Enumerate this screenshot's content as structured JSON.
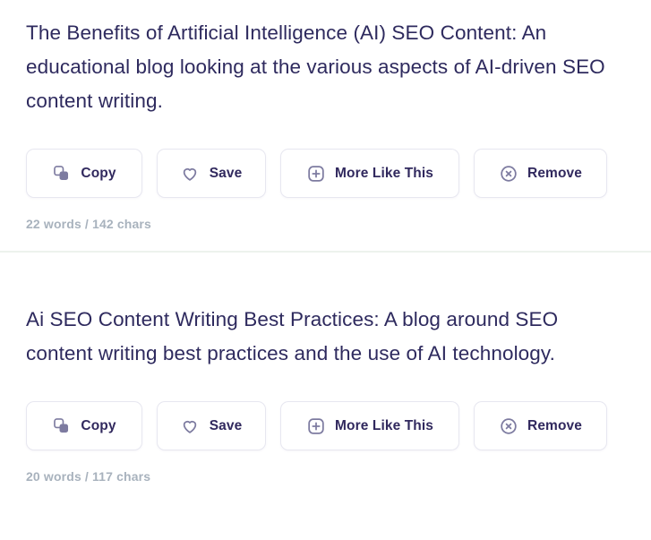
{
  "results": [
    {
      "idea": "The Benefits of Artificial Intelligence (AI) SEO Content: An educational blog looking at the various aspects of AI-driven SEO content writing.",
      "meta": "22 words / 142 chars",
      "actions": [
        {
          "label": "Copy",
          "icon": "copy-icon"
        },
        {
          "label": "Save",
          "icon": "heart-icon"
        },
        {
          "label": "More Like This",
          "icon": "plus-square-icon"
        },
        {
          "label": "Remove",
          "icon": "close-circle-icon"
        }
      ]
    },
    {
      "idea": "Ai SEO Content Writing Best Practices: A blog around SEO content writing best practices and the use of AI technology.",
      "meta": "20 words / 117 chars",
      "actions": [
        {
          "label": "Copy",
          "icon": "copy-icon"
        },
        {
          "label": "Save",
          "icon": "heart-icon"
        },
        {
          "label": "More Like This",
          "icon": "plus-square-icon"
        },
        {
          "label": "Remove",
          "icon": "close-circle-icon"
        }
      ]
    }
  ],
  "colors": {
    "idea_text": "#2e2a5e",
    "button_label": "#31295e",
    "icon": "#7d7ba0",
    "meta_text": "#a8b2bd",
    "border": "#e7e7f0",
    "divider": "#edf2ed",
    "background": "#ffffff"
  }
}
